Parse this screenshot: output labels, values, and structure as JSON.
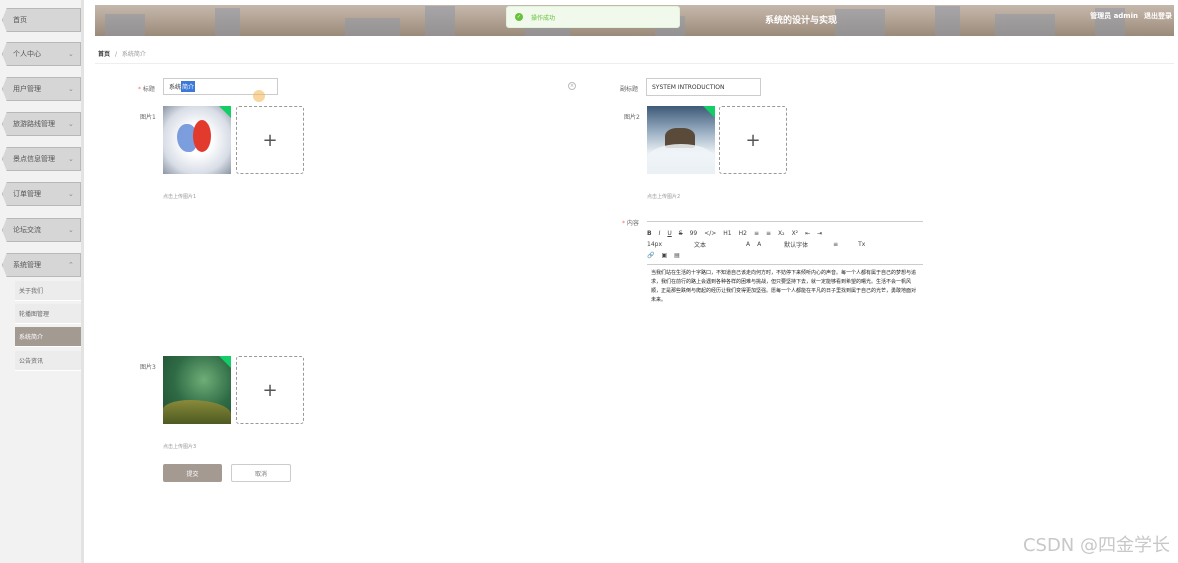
{
  "header": {
    "title": "系统的设计与实现",
    "user": "管理员 admin",
    "logout": "退出登录"
  },
  "toast": {
    "message": "操作成功"
  },
  "breadcrumb": {
    "home": "首页",
    "separator": "/",
    "current": "系统简介"
  },
  "sidebar": {
    "items": [
      {
        "label": "首页"
      },
      {
        "label": "个人中心"
      },
      {
        "label": "用户管理"
      },
      {
        "label": "旅游路线管理"
      },
      {
        "label": "景点信息管理"
      },
      {
        "label": "订单管理"
      },
      {
        "label": "论坛交流"
      },
      {
        "label": "系统管理"
      }
    ],
    "submenu": [
      {
        "label": "关于我们"
      },
      {
        "label": "轮播图管理"
      },
      {
        "label": "系统简介",
        "active": true
      },
      {
        "label": "公告资讯"
      }
    ]
  },
  "form": {
    "title_label": "标题",
    "title_prefix": "系统",
    "title_selected": "简介",
    "subtitle_label": "副标题",
    "subtitle_value": "SYSTEM INTRODUCTION",
    "image1_label": "图片1",
    "image2_label": "图片2",
    "image3_label": "图片3",
    "hint1": "点击上传图片1",
    "hint2": "点击上传图片2",
    "hint3": "点击上传图片3",
    "content_label": "内容",
    "upload_plus": "+",
    "submit_label": "提交",
    "cancel_label": "取消"
  },
  "editor": {
    "toolbar_row1": [
      "B",
      "I",
      "U",
      "S",
      "99",
      "</>",
      "H1",
      "H2",
      "≡",
      "≡",
      "X₂",
      "X²",
      "⇤",
      "⇥"
    ],
    "toolbar_row2": [
      "14px",
      "文本",
      "A",
      "A",
      "默认字体",
      "≡",
      "Tx"
    ],
    "toolbar_row3": [
      "🔗",
      "▣",
      "▤"
    ],
    "content": "当我们站在生活的十字路口，不知道自己该走向何方时，不妨停下来倾听内心的声音。每一个人都有属于自己的梦想与追求，我们在前行的路上会遇到各种各样的困难与挑战，但只要坚持下去，就一定能够看到希望的曙光。生活不会一帆风顺，正是那些跌倒与爬起的经历让我们变得更加坚强。愿每一个人都能在平凡的日子里找到属于自己的光芒，勇敢地面对未来。"
  },
  "colors": {
    "accent": "#a39a92",
    "success": "#67c23a",
    "header_bg": "#b4a496"
  },
  "watermark": "CSDN @四金学长"
}
